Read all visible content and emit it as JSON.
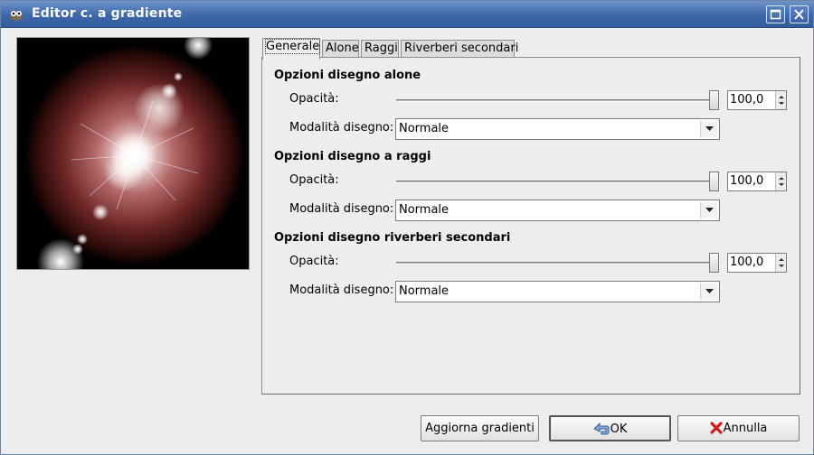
{
  "window": {
    "title": "Editor c. a gradiente",
    "icons": {
      "app": "gimp-wilber-icon",
      "maximize": "maximize-icon",
      "close": "close-icon"
    }
  },
  "preview": {
    "description_icon": "gradient-flare-preview"
  },
  "tabs": [
    {
      "label": "Generale",
      "active": true
    },
    {
      "label": "Alone",
      "active": false
    },
    {
      "label": "Raggi",
      "active": false
    },
    {
      "label": "Riverberi secondari",
      "active": false
    }
  ],
  "sections": [
    {
      "title": "Opzioni disegno alone",
      "opacity_label": "Opacità:",
      "opacity_value": "100,0",
      "opacity_fraction": 1.0,
      "mode_label": "Modalità disegno:",
      "mode_value": "Normale"
    },
    {
      "title": "Opzioni disegno a raggi",
      "opacity_label": "Opacità:",
      "opacity_value": "100,0",
      "opacity_fraction": 1.0,
      "mode_label": "Modalità disegno:",
      "mode_value": "Normale"
    },
    {
      "title": "Opzioni disegno riverberi secondari",
      "opacity_label": "Opacità:",
      "opacity_value": "100,0",
      "opacity_fraction": 1.0,
      "mode_label": "Modalità disegno:",
      "mode_value": "Normale"
    }
  ],
  "buttons": {
    "refresh": "Aggiorna gradienti",
    "ok": "OK",
    "cancel": "Annulla",
    "ok_icon": "undo-arrow-icon",
    "cancel_icon": "red-x-icon"
  },
  "colors": {
    "titlebar": "#3d67a8",
    "flare": "#8a3a3a"
  }
}
